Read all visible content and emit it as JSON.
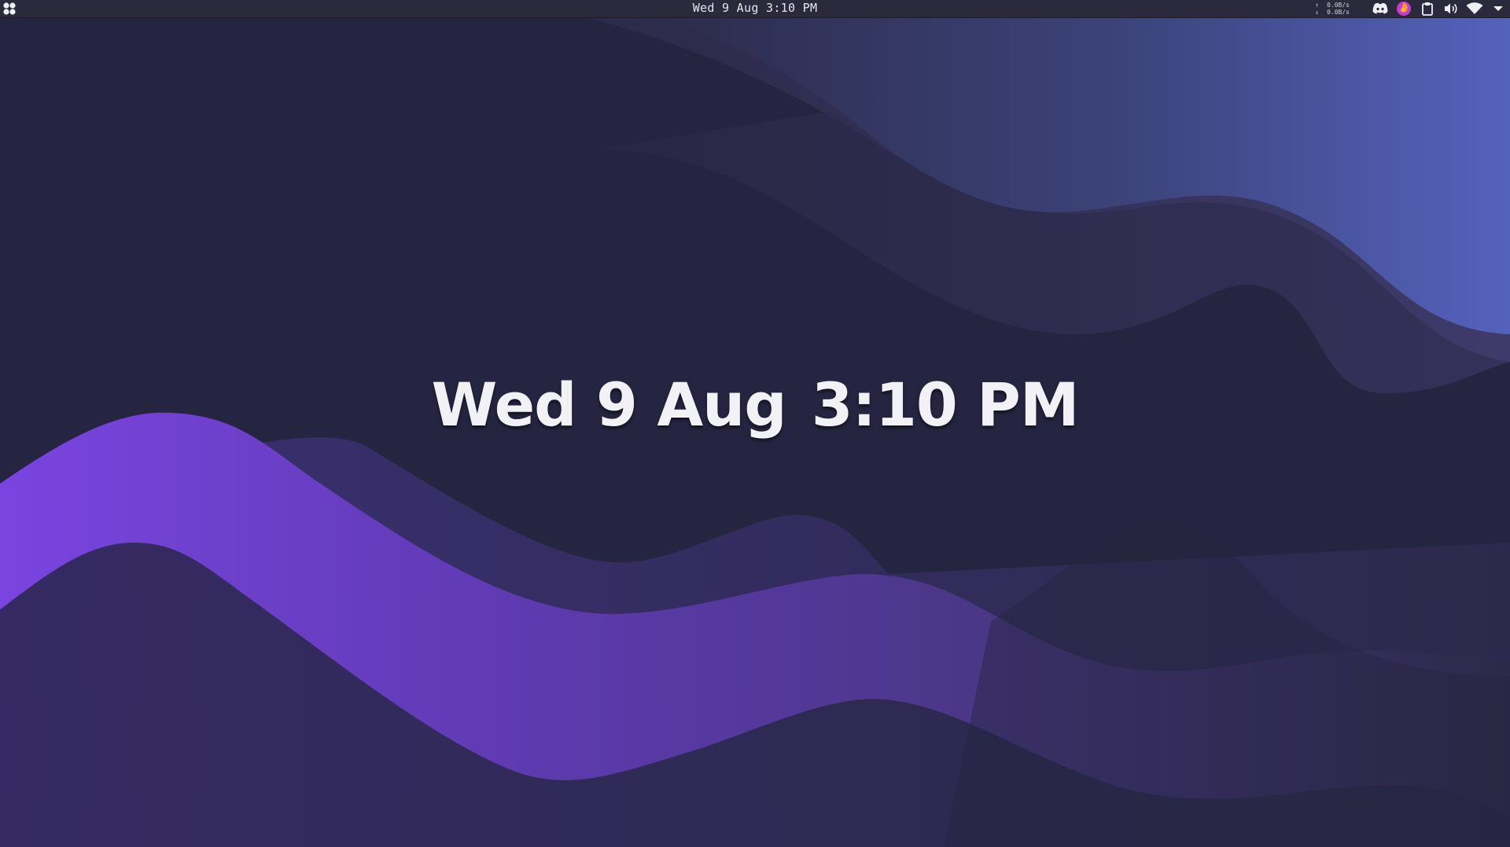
{
  "topbar": {
    "clock_text": "Wed 9 Aug 3:10 PM",
    "net_up": "0.0B/s",
    "net_down": "0.0B/s",
    "net_up_arrow": "↑",
    "net_down_arrow": "↓",
    "tray_icons": [
      "discord-icon",
      "firefox-icon",
      "clipboard-icon",
      "volume-icon",
      "wifi-icon",
      "system-menu-icon"
    ]
  },
  "lockclock": {
    "date": "Wed 9 Aug",
    "time": "3:10 PM"
  },
  "colors": {
    "bar_bg": "#2a2a3c",
    "wallpaper_base": "#262541",
    "wave_purple": "#7b46e0",
    "wave_blue": "#5564be"
  }
}
